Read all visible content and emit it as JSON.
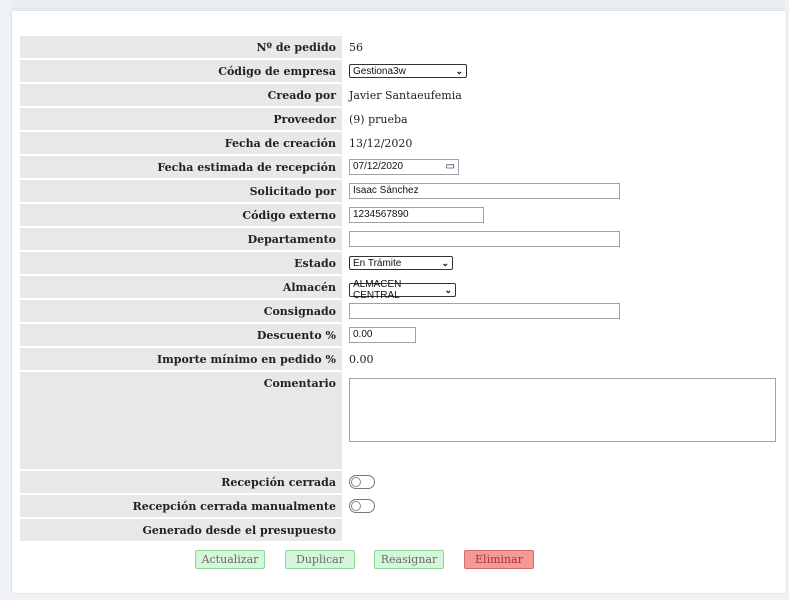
{
  "form": {
    "order_number": {
      "label": "Nº de pedido",
      "value": "56"
    },
    "company_code": {
      "label": "Código de empresa",
      "value": "Gestiona3w"
    },
    "created_by": {
      "label": "Creado por",
      "value": "Javier Santaeufemia"
    },
    "supplier": {
      "label": "Proveedor",
      "value": "(9) prueba"
    },
    "creation_date": {
      "label": "Fecha de creación",
      "value": "13/12/2020"
    },
    "estimated_receipt_date": {
      "label": "Fecha estimada de recepción",
      "value": "07/12/2020"
    },
    "requested_by": {
      "label": "Solicitado por",
      "value": "Isaac Sánchez"
    },
    "external_code": {
      "label": "Código externo",
      "value": "1234567890"
    },
    "department": {
      "label": "Departamento",
      "value": ""
    },
    "status": {
      "label": "Estado",
      "value": "En Trámite"
    },
    "warehouse": {
      "label": "Almacén",
      "value": "ALMACEN CENTRAL"
    },
    "consigned": {
      "label": "Consignado",
      "value": ""
    },
    "discount": {
      "label": "Descuento %",
      "value": "0.00"
    },
    "min_amount": {
      "label": "Importe mínimo en pedido %",
      "value": "0.00"
    },
    "comment": {
      "label": "Comentario",
      "value": ""
    },
    "receipt_closed": {
      "label": "Recepción cerrada",
      "on": false
    },
    "receipt_closed_manual": {
      "label": "Recepción cerrada manualmente",
      "on": false
    },
    "generated_from_quote": {
      "label": "Generado desde el presupuesto",
      "value": ""
    }
  },
  "buttons": {
    "update": "Actualizar",
    "duplicate": "Duplicar",
    "reassign": "Reasignar",
    "delete": "Eliminar"
  },
  "colors": {
    "label_bg": "#e8e8e8",
    "button_green": "#d4f7d9",
    "button_red": "#f19a97"
  }
}
